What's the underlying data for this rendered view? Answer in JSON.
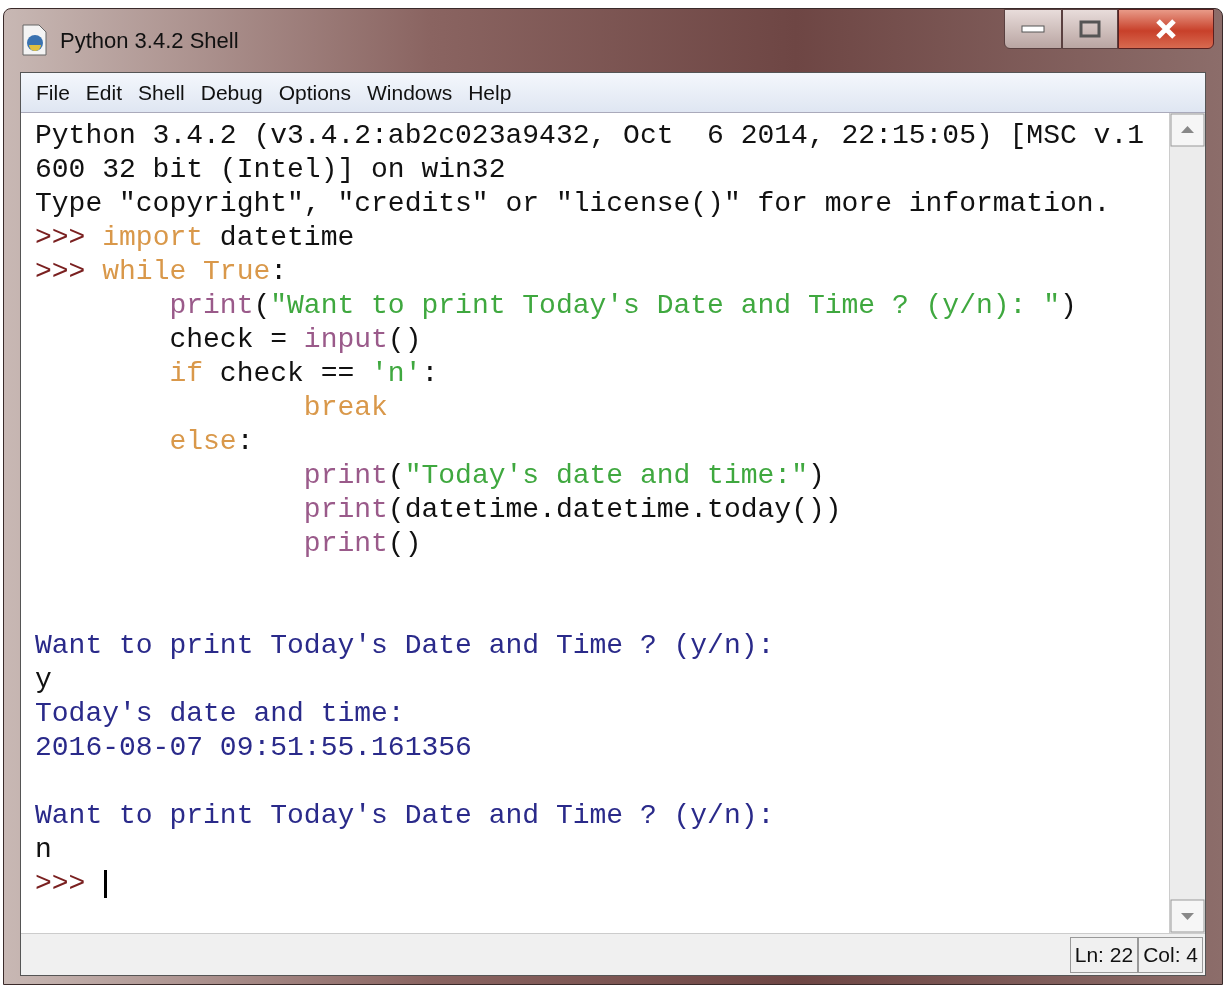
{
  "window": {
    "title": "Python 3.4.2 Shell"
  },
  "menu": [
    {
      "label": "File"
    },
    {
      "label": "Edit"
    },
    {
      "label": "Shell"
    },
    {
      "label": "Debug"
    },
    {
      "label": "Options"
    },
    {
      "label": "Windows"
    },
    {
      "label": "Help"
    }
  ],
  "shell_lines": [
    {
      "kind": "text",
      "segments": [
        {
          "kind": "plain",
          "text": "Python 3.4.2 (v3.4.2:ab2c023a9432, Oct  6 2014, 22:15:05) [MSC v.1"
        }
      ]
    },
    {
      "kind": "text",
      "segments": [
        {
          "kind": "plain",
          "text": "600 32 bit (Intel)] on win32"
        }
      ]
    },
    {
      "kind": "text",
      "segments": [
        {
          "kind": "plain",
          "text": "Type \"copyright\", \"credits\" or \"license()\" for more information."
        }
      ]
    },
    {
      "kind": "text",
      "segments": [
        {
          "kind": "prompt",
          "text": ">>> "
        },
        {
          "kind": "keyword",
          "text": "import"
        },
        {
          "kind": "plain",
          "text": " datetime"
        }
      ]
    },
    {
      "kind": "text",
      "segments": [
        {
          "kind": "prompt",
          "text": ">>> "
        },
        {
          "kind": "keyword",
          "text": "while"
        },
        {
          "kind": "keyword",
          "text": " True"
        },
        {
          "kind": "plain",
          "text": ":"
        }
      ]
    },
    {
      "kind": "text",
      "segments": [
        {
          "kind": "builtin",
          "text": "        print"
        },
        {
          "kind": "plain",
          "text": "("
        },
        {
          "kind": "string",
          "text": "\"Want to print Today's Date and Time ? (y/n): \""
        },
        {
          "kind": "plain",
          "text": ")"
        }
      ]
    },
    {
      "kind": "text",
      "segments": [
        {
          "kind": "plain",
          "text": "        check = "
        },
        {
          "kind": "builtin",
          "text": "input"
        },
        {
          "kind": "plain",
          "text": "()"
        }
      ]
    },
    {
      "kind": "text",
      "segments": [
        {
          "kind": "keyword",
          "text": "        if"
        },
        {
          "kind": "plain",
          "text": " check == "
        },
        {
          "kind": "string",
          "text": "'n'"
        },
        {
          "kind": "plain",
          "text": ":"
        }
      ]
    },
    {
      "kind": "text",
      "segments": [
        {
          "kind": "keyword",
          "text": "                break"
        }
      ]
    },
    {
      "kind": "text",
      "segments": [
        {
          "kind": "keyword",
          "text": "        else"
        },
        {
          "kind": "plain",
          "text": ":"
        }
      ]
    },
    {
      "kind": "text",
      "segments": [
        {
          "kind": "builtin",
          "text": "                print"
        },
        {
          "kind": "plain",
          "text": "("
        },
        {
          "kind": "string",
          "text": "\"Today's date and time:\""
        },
        {
          "kind": "plain",
          "text": ")"
        }
      ]
    },
    {
      "kind": "text",
      "segments": [
        {
          "kind": "builtin",
          "text": "                print"
        },
        {
          "kind": "plain",
          "text": "(datetime.datetime.today())"
        }
      ]
    },
    {
      "kind": "text",
      "segments": [
        {
          "kind": "builtin",
          "text": "                print"
        },
        {
          "kind": "plain",
          "text": "()"
        }
      ]
    },
    {
      "kind": "blank"
    },
    {
      "kind": "blank"
    },
    {
      "kind": "text",
      "segments": [
        {
          "kind": "stdout",
          "text": "Want to print Today's Date and Time ? (y/n): "
        }
      ]
    },
    {
      "kind": "text",
      "segments": [
        {
          "kind": "plain",
          "text": "y"
        }
      ]
    },
    {
      "kind": "text",
      "segments": [
        {
          "kind": "stdout",
          "text": "Today's date and time:"
        }
      ]
    },
    {
      "kind": "text",
      "segments": [
        {
          "kind": "stdout",
          "text": "2016-08-07 09:51:55.161356"
        }
      ]
    },
    {
      "kind": "blank"
    },
    {
      "kind": "text",
      "segments": [
        {
          "kind": "stdout",
          "text": "Want to print Today's Date and Time ? (y/n): "
        }
      ]
    },
    {
      "kind": "text",
      "segments": [
        {
          "kind": "plain",
          "text": "n"
        }
      ]
    },
    {
      "kind": "text",
      "cursor": true,
      "segments": [
        {
          "kind": "prompt",
          "text": ">>> "
        }
      ]
    }
  ],
  "status_bar": {
    "line": "Ln: 22",
    "column": "Col: 4"
  }
}
